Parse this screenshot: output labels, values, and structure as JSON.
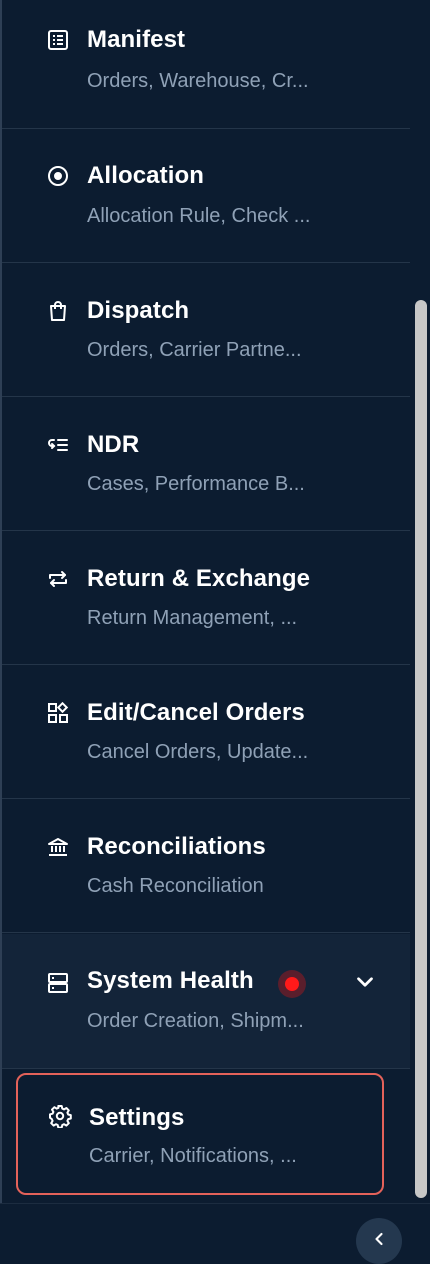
{
  "menu": {
    "items": [
      {
        "title": "Manifest",
        "subtitle": "Orders, Warehouse, Cr...",
        "icon": "list-doc-icon"
      },
      {
        "title": "Allocation",
        "subtitle": "Allocation Rule, Check ...",
        "icon": "target-icon"
      },
      {
        "title": "Dispatch",
        "subtitle": "Orders, Carrier Partne...",
        "icon": "bag-icon"
      },
      {
        "title": "NDR",
        "subtitle": "Cases, Performance B...",
        "icon": "return-list-icon"
      },
      {
        "title": "Return & Exchange",
        "subtitle": "Return Management, ...",
        "icon": "exchange-arrows-icon"
      },
      {
        "title": "Edit/Cancel Orders",
        "subtitle": "Cancel Orders, Update...",
        "icon": "widgets-icon"
      },
      {
        "title": "Reconciliations",
        "subtitle": "Cash Reconciliation",
        "icon": "bank-icon"
      },
      {
        "title": "System Health",
        "subtitle": "Order Creation, Shipm...",
        "icon": "server-icon"
      },
      {
        "title": "Settings",
        "subtitle": "Carrier, Notifications, ...",
        "icon": "gear-icon"
      }
    ]
  },
  "colors": {
    "background": "#0c1c30",
    "title": "#ffffff",
    "subtitle": "#8fa1b6",
    "highlight_border": "#e4625a",
    "status_dot": "#ff1a1a"
  }
}
